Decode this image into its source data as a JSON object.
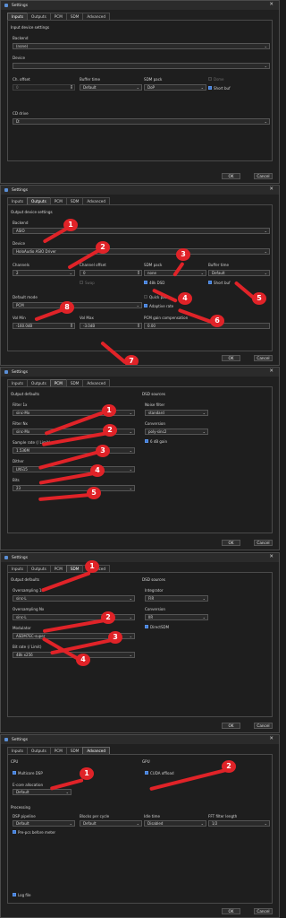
{
  "windows": [
    {
      "title": "Settings",
      "tabs": [
        "Inputs",
        "Outputs",
        "PCM",
        "SDM",
        "Advanced"
      ],
      "active_tab": "Inputs",
      "section": "Input device settings",
      "backend_label": "Backend",
      "backend_value": "(none)",
      "device_label": "Device",
      "device_value": "",
      "ch_offset_label": "Ch. offset",
      "ch_offset_value": "0",
      "buffer_time_label": "Buffer time",
      "buffer_time_value": "Default",
      "sdm_pack_label": "SDM pack",
      "sdm_pack_value": "DoP",
      "dsd_label": "Dsme",
      "short_buf_label": "Short buf",
      "cd_drive_label": "CD drive",
      "cd_drive_value": "D:",
      "ok": "OK",
      "cancel": "Cancel"
    },
    {
      "title": "Settings",
      "tabs": [
        "Inputs",
        "Outputs",
        "PCM",
        "SDM",
        "Advanced"
      ],
      "active_tab": "Outputs",
      "section": "Output device settings",
      "backend_label": "Backend",
      "backend_value": "ASIO",
      "device_label": "Device",
      "device_value": "HoloAudio ASIO Driver",
      "channels_label": "Channels",
      "channels_value": "2",
      "ch_offset_label": "Channel offset",
      "ch_offset_value": "0",
      "sdm_pack_label": "SDM pack",
      "sdm_pack_value": "none",
      "buffer_time_label": "Buffer time",
      "buffer_time_value": "Default",
      "swap_label": "Swap",
      "dsd48k_label": "48k DSD",
      "short_buf_label": "Short buf",
      "default_mode_label": "Default mode",
      "default_mode_value": "PCM",
      "quick_pause_label": "Quick pause",
      "adaptive_rate_label": "Adaptive rate",
      "vol_min_label": "Vol Min",
      "vol_min_value": "-160.0dB",
      "vol_max_label": "Vol Max",
      "vol_max_value": "-3.0dB",
      "pcm_gain_label": "PCM gain compensation",
      "pcm_gain_value": "0.00",
      "ok": "OK",
      "cancel": "Cancel"
    },
    {
      "title": "Settings",
      "tabs": [
        "Inputs",
        "Outputs",
        "PCM",
        "SDM",
        "Advanced"
      ],
      "active_tab": "PCM",
      "section_left": "Output defaults",
      "section_right": "DSD sources",
      "filter1x_label": "Filter 1x",
      "filter1x_value": "sinc-Mx",
      "filterNx_label": "Filter Nx",
      "filterNx_value": "sinc-Mx",
      "sample_rate_label": "Sample rate (/ Limit)",
      "sample_rate_value": "1.536M",
      "dither_label": "Dither",
      "dither_value": "LNS15",
      "bits_label": "Bits",
      "bits_value": "23",
      "noise_filter_label": "Noise filter",
      "noise_filter_value": "standard",
      "conversion_label": "Conversion",
      "conversion_value": "poly-sinc2",
      "gain_label": "6 dB gain",
      "ok": "OK",
      "cancel": "Cancel"
    },
    {
      "title": "Settings",
      "tabs": [
        "Inputs",
        "Outputs",
        "PCM",
        "SDM",
        "Advanced"
      ],
      "active_tab": "SDM",
      "section_left": "Output defaults",
      "section_right": "DSD sources",
      "os1x_label": "Oversampling 1x",
      "os1x_value": "sinc-L",
      "osNx_label": "Oversampling Nx",
      "osNx_value": "sinc-L",
      "modulator_label": "Modulator",
      "modulator_value": "ASDM7EC-super",
      "bitrate_label": "Bit rate (/ Limit)",
      "bitrate_value": "48k x256",
      "integrator_label": "Integrator",
      "integrator_value": "FIR",
      "conversion_label": "Conversion",
      "conversion_value": "IIR",
      "direct_sdm_label": "DirectSDM",
      "ok": "OK",
      "cancel": "Cancel"
    },
    {
      "title": "Settings",
      "tabs": [
        "Inputs",
        "Outputs",
        "PCM",
        "SDM",
        "Advanced"
      ],
      "active_tab": "Advanced",
      "cpu_label": "CPU",
      "gpu_label": "GPU",
      "multicore_label": "Multicore DSP",
      "cuda_label": "CUDA offload",
      "ecore_label": "E-core allocation",
      "ecore_value": "Default",
      "processing_label": "Processing",
      "dsp_pipeline_label": "DSP pipeline",
      "dsp_pipeline_value": "Default",
      "blocks_label": "Blocks per cycle",
      "blocks_value": "Default",
      "idle_label": "Idle time",
      "idle_value": "Disabled",
      "fft_label": "FFT filter length",
      "fft_value": "1/2",
      "pre_pcs_label": "Pre-pcs before meter",
      "log_file_label": "Log file",
      "ok": "OK",
      "cancel": "Cancel"
    }
  ],
  "callouts": {
    "w2": [
      "1",
      "2",
      "3",
      "4",
      "5",
      "6",
      "7",
      "8"
    ],
    "w3": [
      "1",
      "2",
      "3",
      "4",
      "5"
    ],
    "w4": [
      "1",
      "2",
      "3",
      "4"
    ],
    "w5": [
      "1",
      "2"
    ]
  },
  "colors": {
    "callout": "#e02328",
    "accent": "#3d7bd9",
    "window_bg": "#202020"
  }
}
